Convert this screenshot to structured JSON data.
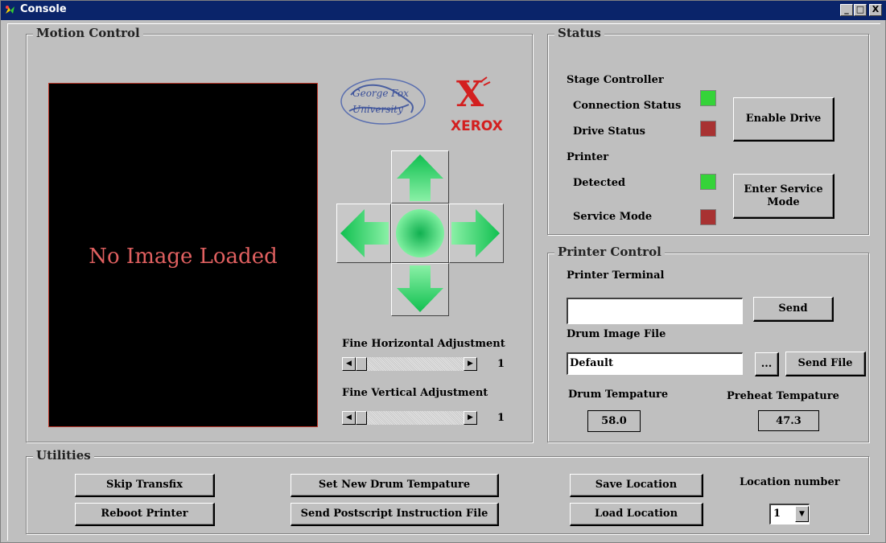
{
  "window": {
    "title": "Console",
    "controls": {
      "minimize": "_",
      "maximize": "□",
      "close": "X"
    }
  },
  "motion": {
    "group_label": "Motion Control",
    "no_image_text": "No Image Loaded",
    "logo_xerox_text": "XEROX",
    "logo_university_text": "George Fox University",
    "fine_horizontal_label": "Fine Horizontal Adjustment",
    "fine_horizontal_value": "1",
    "fine_vertical_label": "Fine Vertical Adjustment",
    "fine_vertical_value": "1"
  },
  "status": {
    "group_label": "Status",
    "stage_controller_label": "Stage Controller",
    "connection_status_label": "Connection Status",
    "drive_status_label": "Drive Status",
    "printer_label": "Printer",
    "detected_label": "Detected",
    "service_mode_label": "Service Mode",
    "enable_drive_button": "Enable Drive",
    "enter_service_mode_button_line1": "Enter Service",
    "enter_service_mode_button_line2": "Mode",
    "colors": {
      "ok": "#35d339",
      "fault": "#a83232"
    }
  },
  "printer_control": {
    "group_label": "Printer Control",
    "terminal_label": "Printer Terminal",
    "terminal_value": "",
    "send_button": "Send",
    "drum_image_file_label": "Drum Image File",
    "drum_image_file_value": "Default",
    "browse_button": "...",
    "send_file_button": "Send File",
    "drum_temp_label": "Drum Tempature",
    "drum_temp_value": "58.0",
    "preheat_temp_label": "Preheat Tempature",
    "preheat_temp_value": "47.3"
  },
  "utilities": {
    "group_label": "Utilities",
    "skip_transfix_button": "Skip Transfix",
    "reboot_printer_button": "Reboot Printer",
    "set_drum_temp_button": "Set New Drum Tempature",
    "send_postscript_button": "Send Postscript Instruction File",
    "save_location_button": "Save Location",
    "load_location_button": "Load Location",
    "location_number_label": "Location number",
    "location_number_value": "1"
  }
}
